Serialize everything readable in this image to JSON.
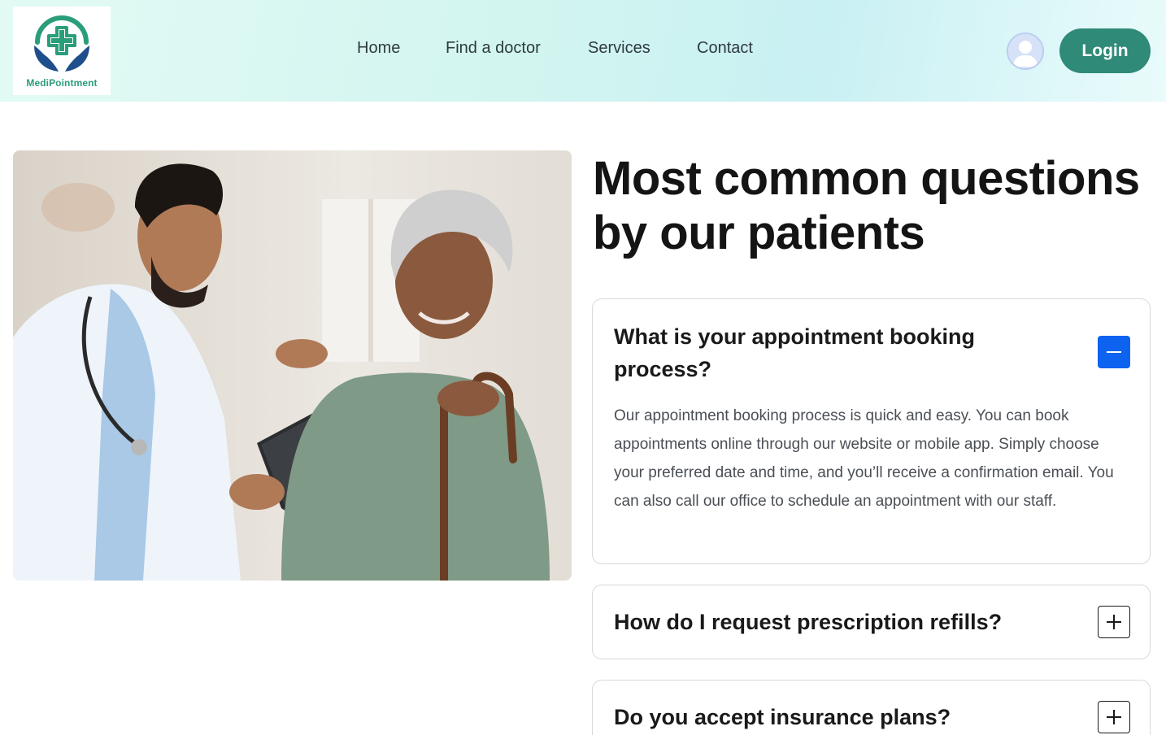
{
  "brand": {
    "name": "MediPointment",
    "accent": "#2f8a77",
    "logo_green": "#2a9d7a",
    "logo_navy": "#1f4e8c"
  },
  "nav": {
    "items": [
      {
        "label": "Home"
      },
      {
        "label": "Find a doctor"
      },
      {
        "label": "Services"
      },
      {
        "label": "Contact"
      }
    ]
  },
  "header": {
    "login_label": "Login",
    "avatar_icon": "user-avatar-icon"
  },
  "hero_image": {
    "description_icon": "doctor-patient-photo"
  },
  "faq": {
    "title": "Most common questions by our patients",
    "items": [
      {
        "question": "What is your appointment booking process?",
        "answer": "Our appointment booking process is quick and easy. You can book appointments online through our website or mobile app. Simply choose your preferred date and time, and you’ll receive a confirmation email. You can also call our office to schedule an appointment with our staff.",
        "expanded": true,
        "toggle_icon": "minus-icon"
      },
      {
        "question": "How do I request prescription refills?",
        "expanded": false,
        "toggle_icon": "plus-icon"
      },
      {
        "question": "Do you accept insurance plans?",
        "expanded": false,
        "toggle_icon": "plus-icon"
      }
    ],
    "open_toggle_color": "#0d63f0"
  }
}
